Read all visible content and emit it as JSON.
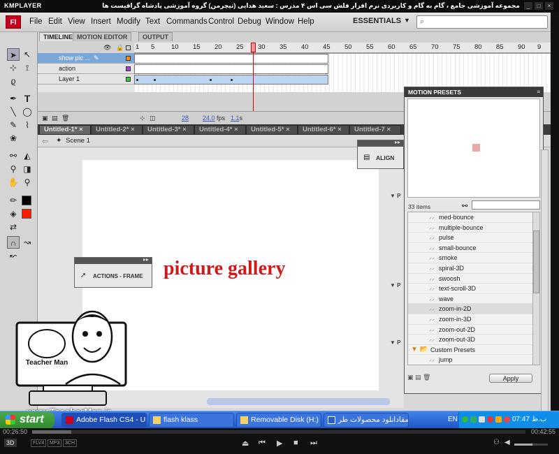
{
  "player": {
    "logo": "KMPLAYER",
    "caption": "مجموعه آموزشی جامع ، گام به گام و کاربردی نرم افزار فلش سی اس ۴ مدرس : سعید هدایی (تیچرمن) گروه آموزشی پادشاه گرافیست ها",
    "time_elapsed": "00:26:50",
    "time_total": "00:42:55",
    "badges": [
      "FLV4",
      "MP3",
      "3CH"
    ],
    "progress": 0.08,
    "volume": 0.55
  },
  "menubar": {
    "app_logo": "Fl",
    "items": [
      "File",
      "Edit",
      "View",
      "Insert",
      "Modify",
      "Text",
      "Commands",
      "Control",
      "Debug",
      "Window",
      "Help"
    ],
    "workspace": "ESSENTIALS"
  },
  "timeline": {
    "tabs": [
      "TIMELINE",
      "MOTION EDITOR",
      "OUTPUT"
    ],
    "ticks": [
      "1",
      "5",
      "10",
      "15",
      "20",
      "25",
      "30",
      "35",
      "40",
      "45",
      "50",
      "55",
      "60",
      "65",
      "70",
      "75",
      "80",
      "85",
      "90",
      "9"
    ],
    "layers": [
      {
        "name": "show pic ...",
        "color": "#ff8a00"
      },
      {
        "name": "action",
        "color": "#b040d0"
      },
      {
        "name": "Layer 1",
        "color": "#39c539"
      }
    ],
    "current_frame": "28",
    "fps": "24.0",
    "fps_unit": "fps",
    "time": "1.1",
    "time_unit": "s"
  },
  "doc_tabs": [
    "Untitled-1*",
    "Untitled-2*",
    "Untitled-3*",
    "Untitled-4*",
    "Untitled-5*",
    "Untitled-6*",
    "Untitled-7"
  ],
  "scene": "Scene 1",
  "stage": {
    "heading": "picture gallery"
  },
  "panels": {
    "align": "ALIGN",
    "actions": "ACTIONS - FRAME"
  },
  "motion_presets": {
    "title": "MOTION PRESETS",
    "count": "33 items",
    "items": [
      "med-bounce",
      "multiple-bounce",
      "pulse",
      "small-bounce",
      "smoke",
      "spiral-3D",
      "swoosh",
      "text-scroll-3D",
      "wave",
      "zoom-in-2D",
      "zoom-in-3D",
      "zoom-out-2D",
      "zoom-out-3D"
    ],
    "selected": "zoom-in-2D",
    "folder": "Custom Presets",
    "folder_items": [
      "jump"
    ],
    "apply": "Apply"
  },
  "watermark": {
    "url": "www.TeacherMan.ir",
    "name": "Teacher Man"
  },
  "taskbar": {
    "start": "start",
    "tasks": [
      "Adobe Flash CS4 - Un...",
      "flash klass",
      "Removable Disk (H:)",
      "مقادانلود محصولات طر"
    ],
    "lang": "EN",
    "clock": "07:47 ب.ظ"
  }
}
